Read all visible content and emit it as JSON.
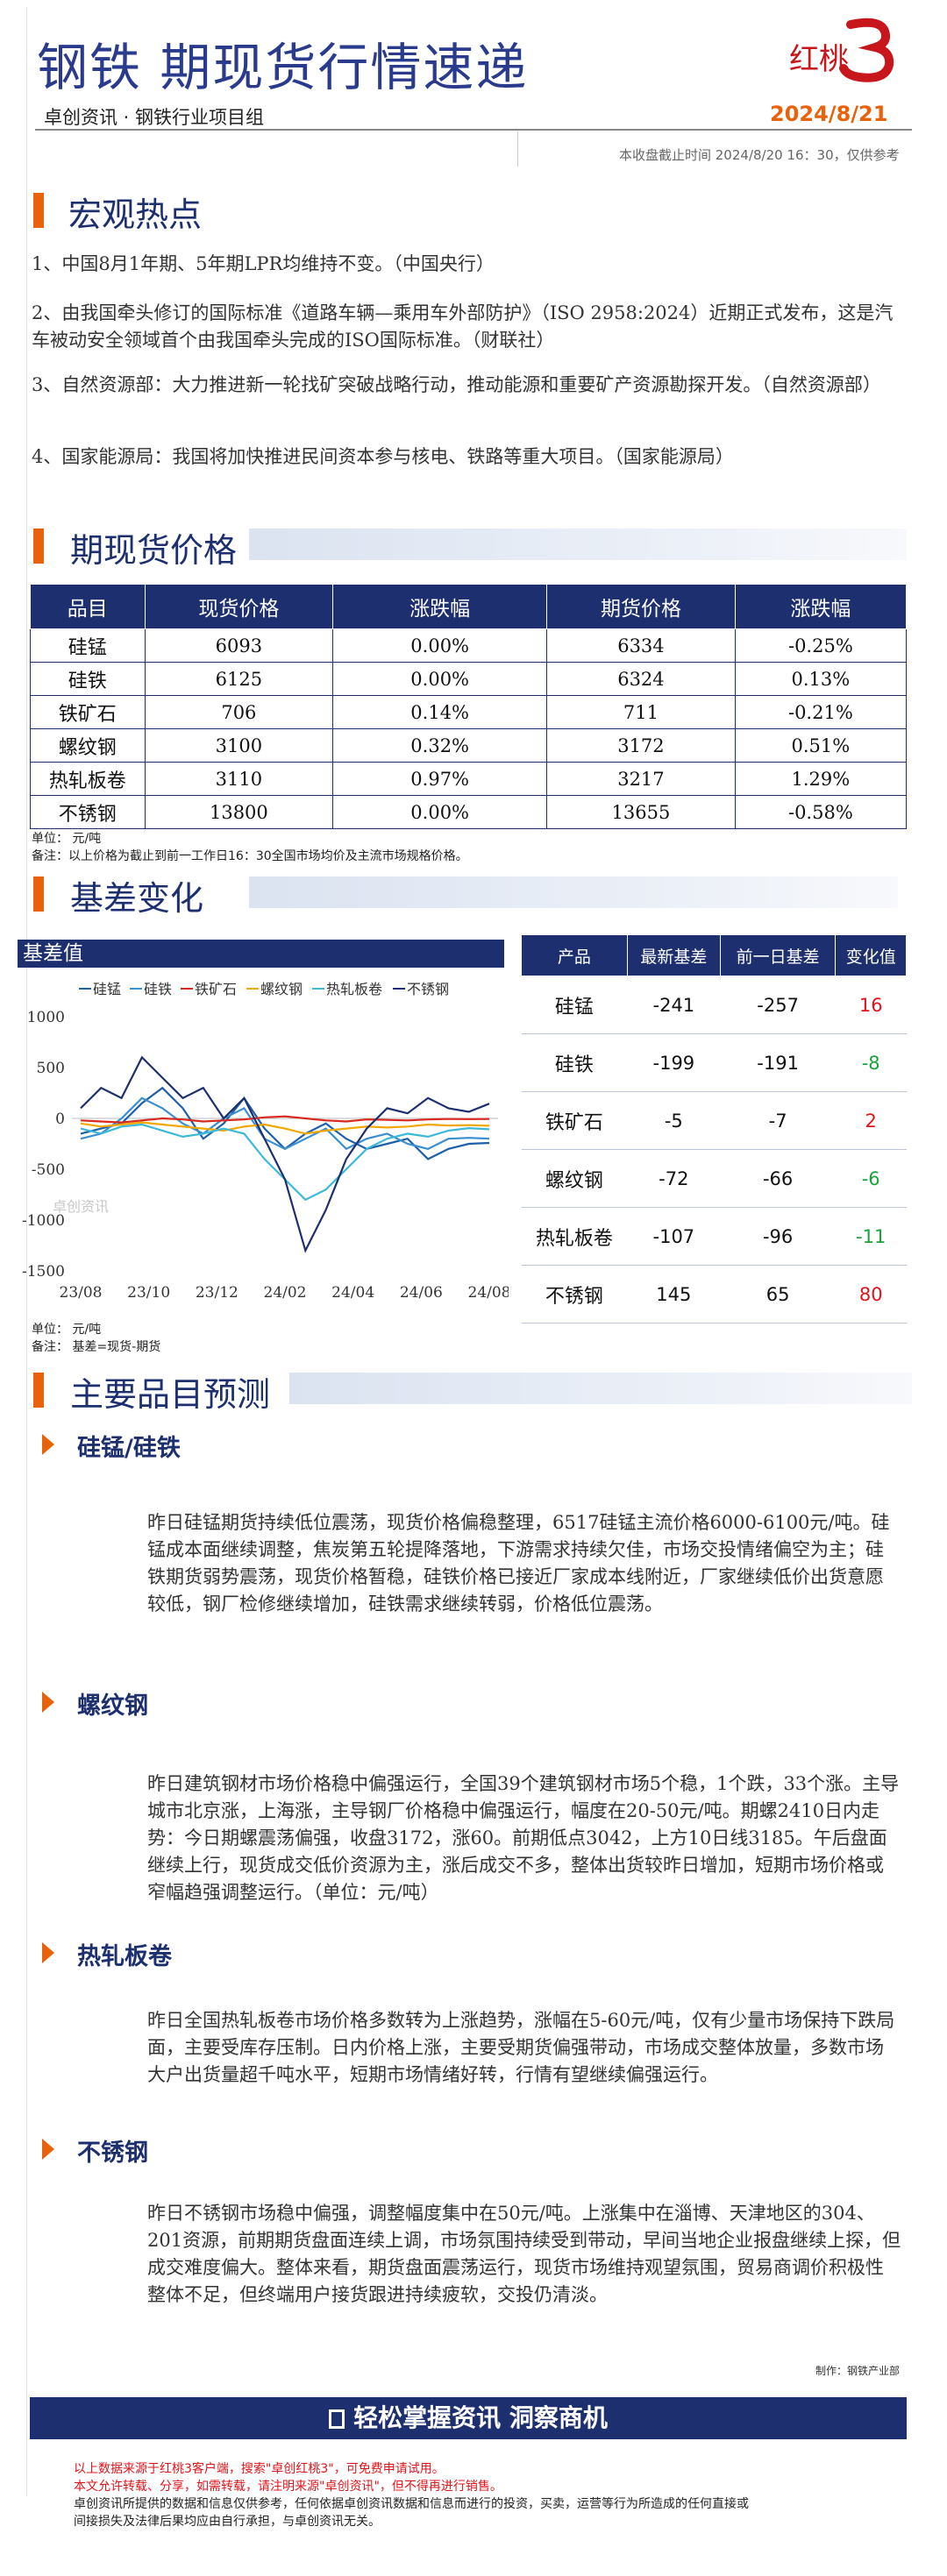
{
  "header": {
    "title": "钢铁  期现货行情速递",
    "logo_text": "红桃",
    "subtitle": "卓创资讯 · 钢铁行业项目组",
    "date": "2024/8/21",
    "note": "本收盘截止时间    2024/8/20    16：30，仅供参考"
  },
  "macro": {
    "title": "宏观热点",
    "items": [
      "1、中国8月1年期、5年期LPR均维持不变。（中国央行）",
      "2、由我国牵头修订的国际标准《道路车辆—乘用车外部防护》（ISO 2958:2024）近期正式发布，这是汽车被动安全领域首个由我国牵头完成的ISO国际标准。（财联社）",
      "3、自然资源部：大力推进新一轮找矿突破战略行动，推动能源和重要矿产资源勘探开发。（自然资源部）",
      "4、国家能源局：我国将加快推进民间资本参与核电、铁路等重大项目。（国家能源局）"
    ]
  },
  "prices": {
    "title": "期现货价格",
    "headers": [
      "品目",
      "现货价格",
      "涨跌幅",
      "期货价格",
      "涨跌幅"
    ],
    "rows": [
      [
        "硅锰",
        "6093",
        "0.00%",
        "6334",
        "-0.25%"
      ],
      [
        "硅铁",
        "6125",
        "0.00%",
        "6324",
        "0.13%"
      ],
      [
        "铁矿石",
        "706",
        "0.14%",
        "711",
        "-0.21%"
      ],
      [
        "螺纹钢",
        "3100",
        "0.32%",
        "3172",
        "0.51%"
      ],
      [
        "热轧板卷",
        "3110",
        "0.97%",
        "3217",
        "1.29%"
      ],
      [
        "不锈钢",
        "13800",
        "0.00%",
        "13655",
        "-0.58%"
      ]
    ],
    "unit": "单位：  元/吨",
    "note": "备注：以上价格为截止到前一工作日16：30全国市场均价及主流市场规格价格。"
  },
  "basis": {
    "title": "基差变化",
    "chart_label": "基差值",
    "unit": "单位：  元/吨",
    "note": "备注：  基差=现货-期货",
    "headers": [
      "产品",
      "最新基差",
      "前一日基差",
      "变化值"
    ],
    "rows": [
      {
        "name": "硅锰",
        "latest": "-241",
        "prev": "-257",
        "change": "16",
        "dir": "up"
      },
      {
        "name": "硅铁",
        "latest": "-199",
        "prev": "-191",
        "change": "-8",
        "dir": "down"
      },
      {
        "name": "铁矿石",
        "latest": "-5",
        "prev": "-7",
        "change": "2",
        "dir": "up"
      },
      {
        "name": "螺纹钢",
        "latest": "-72",
        "prev": "-66",
        "change": "-6",
        "dir": "down"
      },
      {
        "name": "热轧板卷",
        "latest": "-107",
        "prev": "-96",
        "change": "-11",
        "dir": "down"
      },
      {
        "name": "不锈钢",
        "latest": "145",
        "prev": "65",
        "change": "80",
        "dir": "up"
      }
    ],
    "colors": {
      "up": "#e0141b",
      "down": "#19a33a"
    }
  },
  "chart_data": {
    "type": "line",
    "title": "",
    "xlabel": "",
    "ylabel": "",
    "ylim": [
      -1500,
      1000
    ],
    "yticks": [
      "1000",
      "500",
      "0",
      "-500",
      "-1000",
      "-1500"
    ],
    "xticks": [
      "23/08",
      "23/10",
      "23/12",
      "24/02",
      "24/04",
      "24/06",
      "24/08"
    ],
    "watermark": "卓创资讯",
    "legend_position": "top",
    "series": [
      {
        "name": "硅锰",
        "color": "#1f5fa8",
        "values": [
          -150,
          -100,
          -50,
          150,
          300,
          100,
          -200,
          -50,
          200,
          -100,
          -300,
          -150,
          -50,
          -200,
          -300,
          -250,
          -200,
          -400,
          -300,
          -250,
          -241
        ]
      },
      {
        "name": "硅铁",
        "color": "#3a8fd0",
        "values": [
          -200,
          -150,
          0,
          200,
          100,
          -50,
          -150,
          0,
          100,
          -200,
          -300,
          -200,
          -100,
          -300,
          -200,
          -150,
          -250,
          -300,
          -200,
          -191,
          -199
        ]
      },
      {
        "name": "铁矿石",
        "color": "#d9281e",
        "values": [
          -20,
          -30,
          -40,
          -20,
          0,
          -10,
          -30,
          -20,
          -10,
          10,
          20,
          0,
          -20,
          -30,
          -10,
          -15,
          -20,
          -10,
          -5,
          -7,
          -5
        ]
      },
      {
        "name": "螺纹钢",
        "color": "#f0a800",
        "values": [
          -50,
          -80,
          -60,
          -40,
          -60,
          -80,
          -100,
          -120,
          -80,
          -60,
          -100,
          -150,
          -120,
          -100,
          -80,
          -90,
          -80,
          -60,
          -70,
          -66,
          -72
        ]
      },
      {
        "name": "热轧板卷",
        "color": "#3cb9d8",
        "values": [
          -100,
          -150,
          -80,
          -60,
          -120,
          -180,
          -150,
          -100,
          -150,
          -400,
          -600,
          -800,
          -700,
          -500,
          -300,
          -200,
          -150,
          -180,
          -120,
          -96,
          -107
        ]
      },
      {
        "name": "不锈钢",
        "color": "#1d2f6f",
        "values": [
          100,
          300,
          200,
          600,
          400,
          200,
          300,
          0,
          200,
          -200,
          -600,
          -1300,
          -900,
          -400,
          -100,
          100,
          50,
          200,
          100,
          65,
          145
        ]
      }
    ]
  },
  "forecast": {
    "title": "主要品目预测",
    "items": [
      {
        "title": "硅锰/硅铁",
        "text": "昨日硅锰期货持续低位震荡，现货价格偏稳整理，6517硅锰主流价格6000-6100元/吨。硅锰成本面继续调整，焦炭第五轮提降落地，下游需求持续欠佳，市场交投情绪偏空为主；硅铁期货弱势震荡，现货价格暂稳，硅铁价格已接近厂家成本线附近，厂家继续低价出货意愿较低，钢厂检修继续增加，硅铁需求继续转弱，价格低位震荡。"
      },
      {
        "title": "螺纹钢",
        "text": "昨日建筑钢材市场价格稳中偏强运行，全国39个建筑钢材市场5个稳，1个跌，33个涨。主导城市北京涨，上海涨，主导钢厂价格稳中偏强运行，幅度在20-50元/吨。期螺2410日内走势：今日期螺震荡偏强，收盘3172，涨60。前期低点3042，上方10日线3185。午后盘面继续上行，现货成交低价资源为主，涨后成交不多，整体出货较昨日增加，短期市场价格或窄幅趋强调整运行。（单位：元/吨）"
      },
      {
        "title": "热轧板卷",
        "text": "昨日全国热轧板卷市场价格多数转为上涨趋势，涨幅在5-60元/吨，仅有少量市场保持下跌局面，主要受库存压制。日内价格上涨，主要受期货偏强带动，市场成交整体放量，多数市场大户出货量超千吨水平，短期市场情绪好转，行情有望继续偏强运行。"
      },
      {
        "title": "不锈钢",
        "text": "昨日不锈钢市场稳中偏强，调整幅度集中在50元/吨。上涨集中在淄博、天津地区的304、201资源，前期期货盘面连续上调，市场氛围持续受到带动，早间当地企业报盘继续上探，但成交难度偏大。整体来看，期货盘面震荡运行，现货市场维持观望氛围，贸易商调价积极性整体不足，但终端用户接货跟进持续疲软，交投仍清淡。"
      }
    ],
    "author": "制作：钢铁产业部"
  },
  "footer": {
    "banner": "轻松掌握资讯 洞察商机",
    "red_lines": [
      "以上数据来源于红桃3客户端，搜索\"卓创红桃3\"，可免费申请试用。",
      "本文允许转载、分享，如需转载，请注明来源\"卓创资讯\"，但不得再进行销售。"
    ],
    "black_lines": [
      "卓创资讯所提供的数据和信息仅供参考，任何依据卓创资讯数据和信息而进行的投资，买卖，运营等行为所造成的任何直接或",
      "间接损失及法律后果均应由自行承担，与卓创资讯无关。"
    ]
  }
}
